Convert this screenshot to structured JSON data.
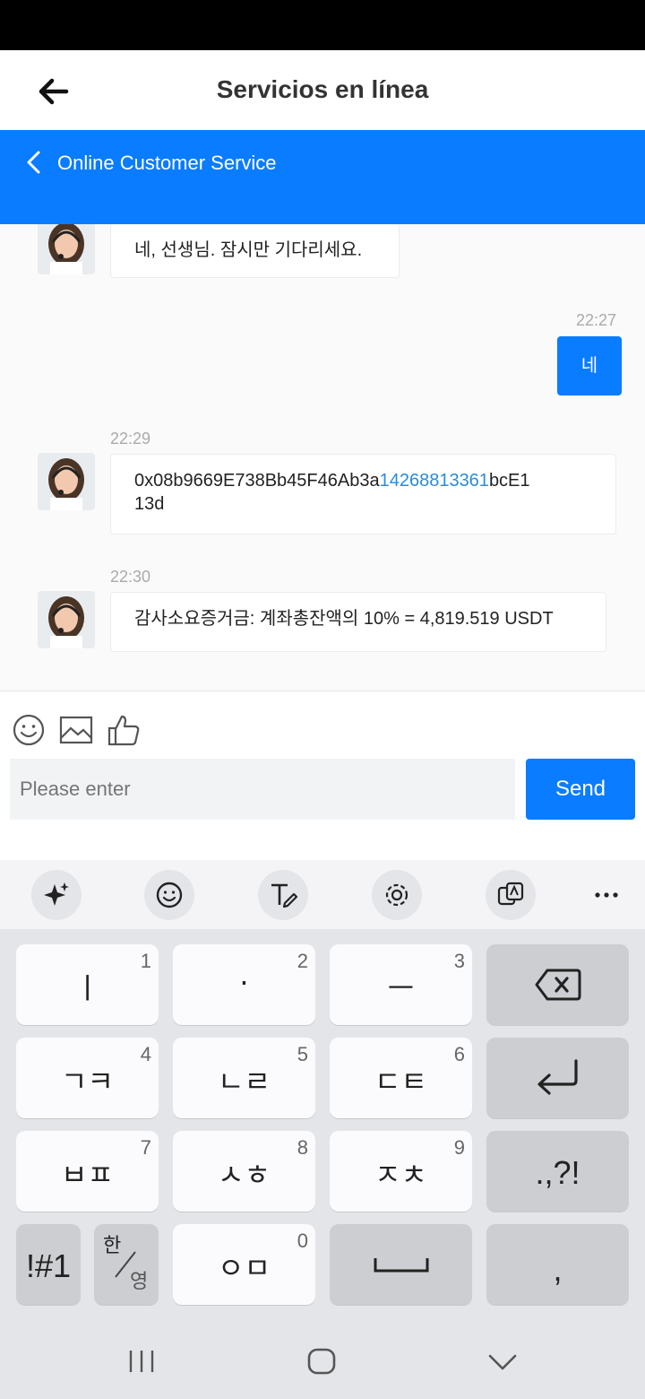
{
  "topbar": {
    "title": "Servicios en línea"
  },
  "service_header": {
    "label": "Online Customer Service"
  },
  "messages": [
    {
      "text": "네, 선생님. 잠시만 기다리세요."
    },
    {
      "time": "22:27",
      "text": "네"
    },
    {
      "time": "22:29",
      "text_a": "0x08b9669E738Bb45F46Ab3a",
      "text_link": "14268813361",
      "text_b": "bcE1",
      "text_c": "13d"
    },
    {
      "time": "22:30",
      "text": "감사소요증거금: 계좌총잔액의 10% = 4,819.519 USDT"
    }
  ],
  "composer": {
    "placeholder": "Please enter",
    "send_label": "Send"
  },
  "keyboard": {
    "keys": [
      {
        "glyph": "ㅣ",
        "num": "1"
      },
      {
        "glyph": "·",
        "num": "2"
      },
      {
        "glyph": "ㅡ",
        "num": "3"
      },
      {
        "glyph": "ㄱㅋ",
        "num": "4"
      },
      {
        "glyph": "ㄴㄹ",
        "num": "5"
      },
      {
        "glyph": "ㄷㅌ",
        "num": "6"
      },
      {
        "glyph": "ㅂㅍ",
        "num": "7"
      },
      {
        "glyph": "ㅅㅎ",
        "num": "8"
      },
      {
        "glyph": "ㅈㅊ",
        "num": "9"
      },
      {
        "glyph": "ㅇㅁ",
        "num": "0"
      }
    ],
    "punct": ".,?!",
    "comma": ",",
    "symbols": "!#1",
    "lang_top": "한",
    "lang_bottom": "영"
  },
  "colors": {
    "accent": "#0a7cff",
    "link": "#2a8bdc"
  }
}
